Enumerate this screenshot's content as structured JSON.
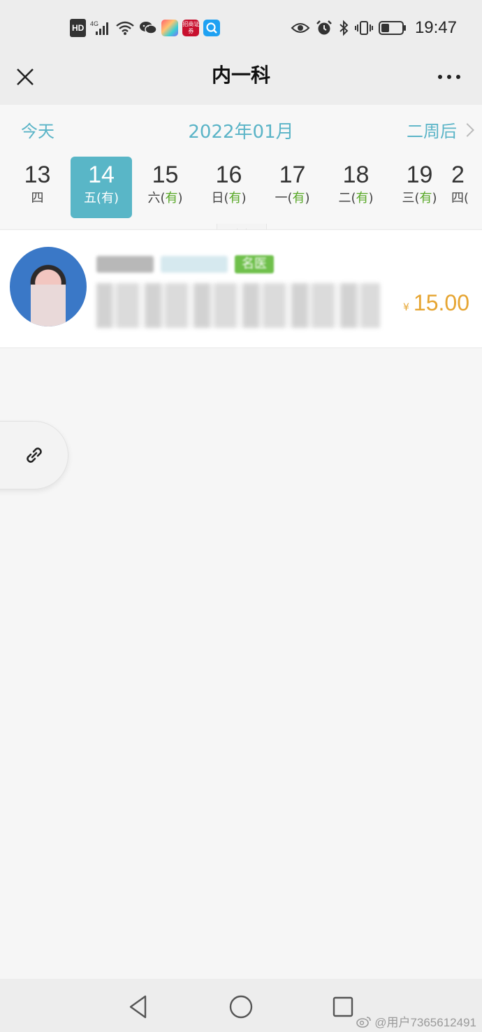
{
  "status_bar": {
    "hd": "HD",
    "network": "4G",
    "icons_left": [
      "hd-icon",
      "signal-icon",
      "wifi-icon",
      "wechat-icon",
      "colorful-app-icon",
      "securities-app-icon",
      "search-app-icon"
    ],
    "securities_app_text": "招商证券",
    "icons_right": [
      "eye-icon",
      "alarm-icon",
      "bluetooth-icon",
      "vibrate-icon",
      "battery-icon"
    ],
    "time": "19:47"
  },
  "title_bar": {
    "title": "内一科",
    "close_icon": "close-icon",
    "more_icon": "more-icon"
  },
  "calendar": {
    "today_label": "今天",
    "month": "2022年01月",
    "next_label": "二周后",
    "days": [
      {
        "num": "13",
        "weekday": "四",
        "avail": ""
      },
      {
        "num": "14",
        "weekday": "五(",
        "avail": "有",
        "close": ")",
        "selected": true
      },
      {
        "num": "15",
        "weekday": "六(",
        "avail": "有",
        "close": ")"
      },
      {
        "num": "16",
        "weekday": "日(",
        "avail": "有",
        "close": ")"
      },
      {
        "num": "17",
        "weekday": "一(",
        "avail": "有",
        "close": ")"
      },
      {
        "num": "18",
        "weekday": "二(",
        "avail": "有",
        "close": ")"
      },
      {
        "num": "19",
        "weekday": "三(",
        "avail": "有",
        "close": ")"
      },
      {
        "num": "2",
        "weekday": "四(",
        "avail": "",
        "close": ""
      }
    ]
  },
  "doctor": {
    "tag": "名医",
    "price_currency": "¥",
    "price": "15.00"
  },
  "watermark": "@用户7365612491",
  "colors": {
    "accent": "#59b6c7",
    "available": "#58a827",
    "price": "#e6a532",
    "tag": "#6fc04b"
  }
}
